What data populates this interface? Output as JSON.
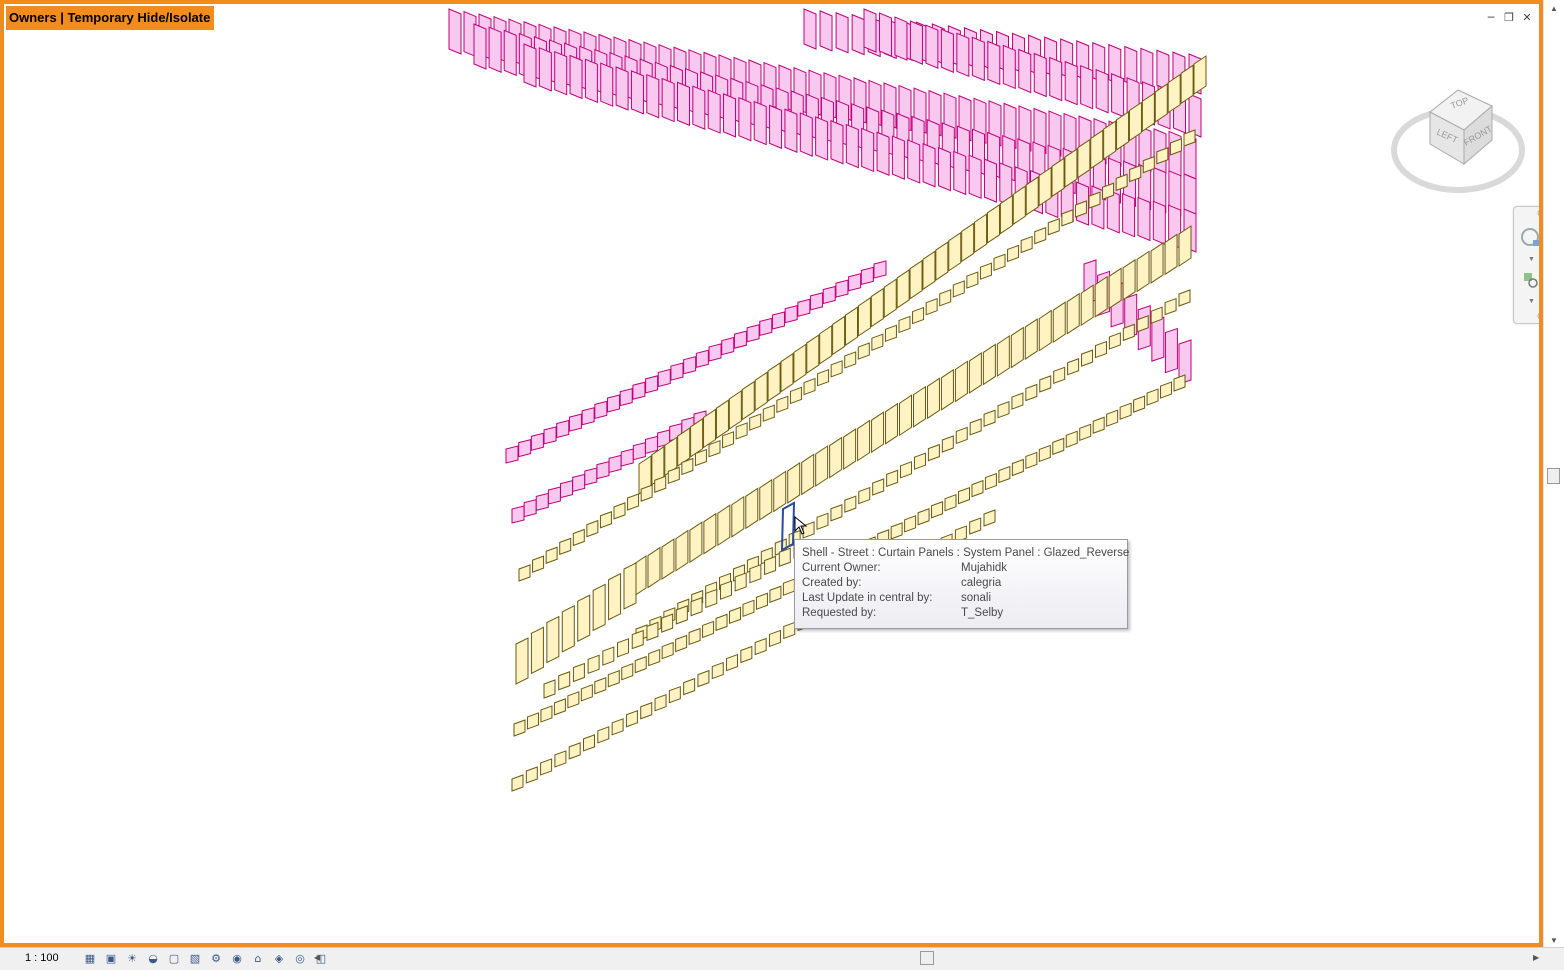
{
  "view": {
    "mode_label": "Owners | Temporary Hide/Isolate",
    "window_buttons": [
      "minimize-icon",
      "restore-icon",
      "close-icon"
    ],
    "frame_color": "#f28c1e"
  },
  "viewcube": {
    "top": "TOP",
    "left": "LEFT",
    "front": "FRONT"
  },
  "tooltip": {
    "title": "Shell - Street : Curtain Panels : System Panel : Glazed_Reverse",
    "rows": [
      {
        "label": "Current Owner:",
        "value": "Mujahidk"
      },
      {
        "label": "Created by:",
        "value": "calegria"
      },
      {
        "label": "Last Update in central by:",
        "value": "sonali"
      },
      {
        "label": "Requested by:",
        "value": "T_Selby"
      }
    ]
  },
  "status_bar": {
    "scale": "1 : 100",
    "icons": [
      "detail-level-icon",
      "visual-style-icon",
      "sun-path-icon",
      "shadows-icon",
      "crop-view-icon",
      "show-crop-icon",
      "temporary-hide-icon",
      "reveal-hidden-icon",
      "worksharing-icon",
      "analytical-model-icon",
      "highlight-displacement-icon",
      "constraints-icon"
    ]
  },
  "colors": {
    "magenta_panels": "#c0007a",
    "magenta_fill": "#f8c8ee",
    "yellow_panels": "#6b5a10",
    "yellow_fill": "#fff3c4",
    "highlight": "#2c4aa0"
  }
}
